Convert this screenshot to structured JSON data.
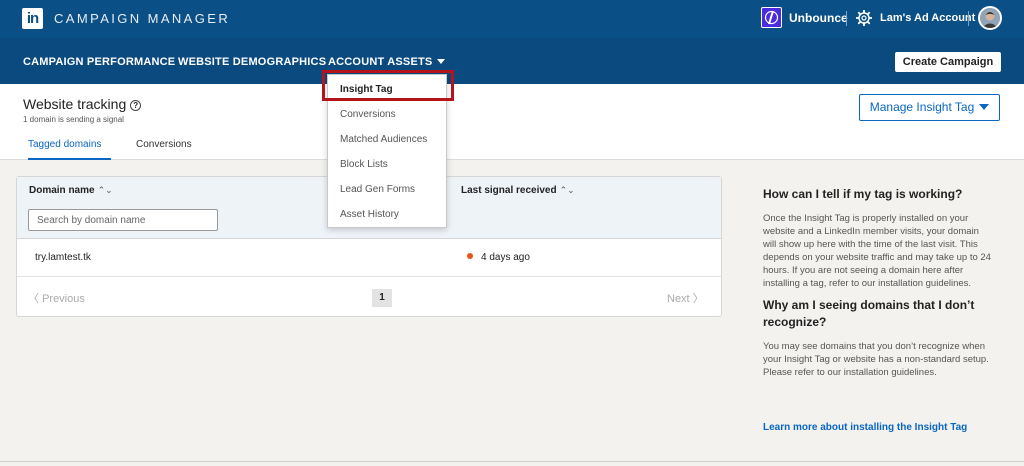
{
  "topbar": {
    "logo_text": "in",
    "brand": "CAMPAIGN MANAGER",
    "account_name": "Unbounce",
    "ad_account": "Lam's Ad Account"
  },
  "nav": {
    "items": [
      {
        "label": "CAMPAIGN PERFORMANCE"
      },
      {
        "label": "WEBSITE DEMOGRAPHICS"
      },
      {
        "label": "ACCOUNT ASSETS"
      }
    ],
    "create_button": "Create Campaign"
  },
  "header": {
    "title": "Website tracking",
    "help_glyph": "?",
    "subtitle": "1 domain is sending a signal",
    "manage_button": "Manage Insight Tag",
    "tabs": [
      {
        "label": "Tagged domains",
        "active": true
      },
      {
        "label": "Conversions",
        "active": false
      }
    ]
  },
  "table": {
    "columns": [
      "Domain name",
      "Last signal received"
    ],
    "sort_glyph": "⌃⌄",
    "search_placeholder": "Search by domain name",
    "rows": [
      {
        "domain": "try.lamtest.tk",
        "last_signal": "4 days ago",
        "status_color": "#e8541c"
      }
    ],
    "pager": {
      "prev": "Previous",
      "next": "Next",
      "page": "1"
    }
  },
  "menu": {
    "items": [
      {
        "label": "Insight Tag",
        "active": true
      },
      {
        "label": "Conversions",
        "active": false
      },
      {
        "label": "Matched Audiences",
        "active": false
      },
      {
        "label": "Block Lists",
        "active": false
      },
      {
        "label": "Lead Gen Forms",
        "active": false
      },
      {
        "label": "Asset History",
        "active": false
      }
    ],
    "highlight_color": "#b3151b"
  },
  "info": {
    "q1": "How can I tell if my tag is working?",
    "a1": "Once the Insight Tag is properly installed on your website and a LinkedIn member visits, your domain will show up here with the time of the last visit. This depends on your website traffic and may take up to 24 hours. If you are not seeing a domain here after installing a tag, refer to our installation guidelines.",
    "q2": "Why am I seeing domains that I don’t recognize?",
    "a2": "You may see domains that you don’t recognize when your Insight Tag or website has a non-standard setup. Please refer to our installation guidelines.",
    "link": "Learn more about installing the Insight Tag"
  },
  "colors": {
    "topbar": "#0b4f87",
    "accent": "#0a66c2"
  }
}
